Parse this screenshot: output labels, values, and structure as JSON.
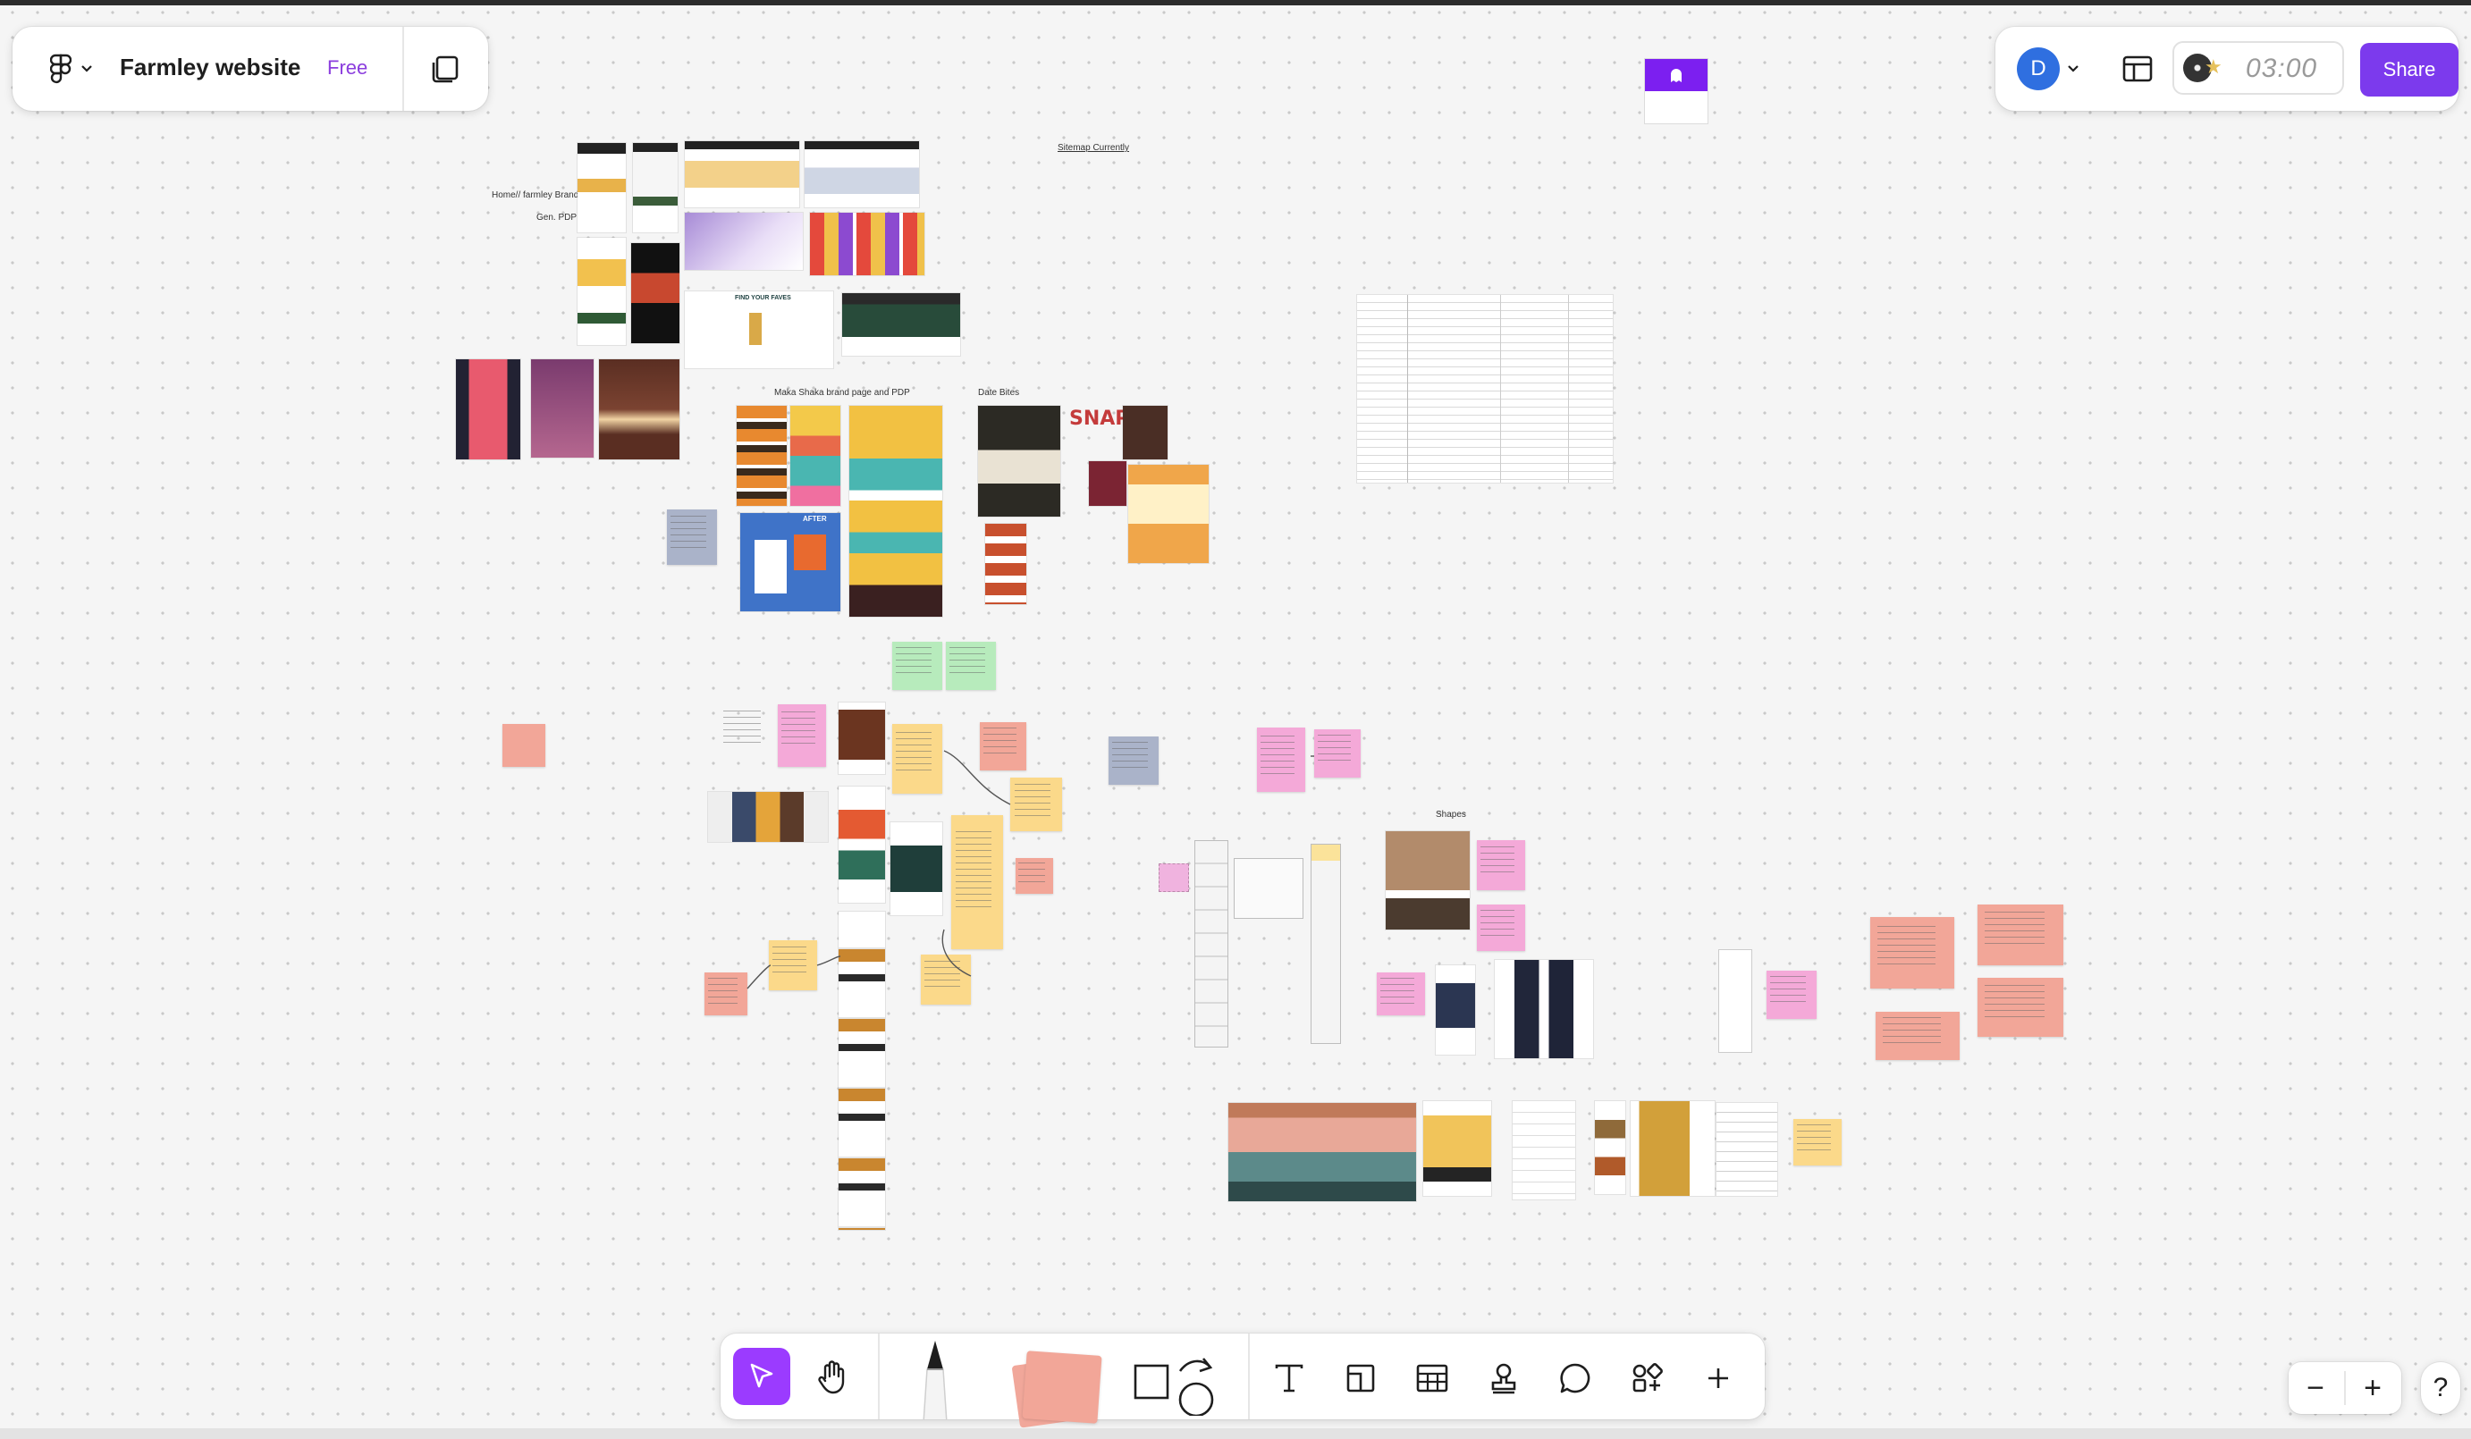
{
  "file": {
    "name": "Farmley website",
    "plan_badge": "Free"
  },
  "header": {
    "avatar_initial": "D",
    "timer": "03:00",
    "share_label": "Share"
  },
  "canvas": {
    "labels": {
      "home_brand": "Home// farmley Brand",
      "gen_pdp": "Gen. PDP",
      "sitemap": "Sitemap Currently",
      "maka_shaka": "Maka Shaka brand page and PDP",
      "date_bites": "Date Bites",
      "shapes": "Shapes",
      "find_your_faves": "FIND YOUR FAVES",
      "snap": "SNAP",
      "after": "AFTER",
      "faves": "FAVES"
    }
  },
  "toolbar": {
    "tools": [
      "move-tool",
      "hand-tool",
      "pencil-tool",
      "sticky-note-tool",
      "shape-tool",
      "connector-tool",
      "text-tool",
      "section-tool",
      "table-tool",
      "stamp-tool",
      "comment-tool",
      "widgets-tool",
      "add-tool"
    ]
  },
  "zoom": {
    "out_label": "−",
    "in_label": "+",
    "help_label": "?"
  },
  "colors": {
    "accent": "#7c3aed",
    "brand_blue": "#2f6fe0",
    "sticky_yellow": "#fbd98a",
    "sticky_pink": "#f4a9d8",
    "sticky_salmon": "#f2a698",
    "sticky_green": "#b7ebbc",
    "sticky_blue": "#aab3c9"
  }
}
